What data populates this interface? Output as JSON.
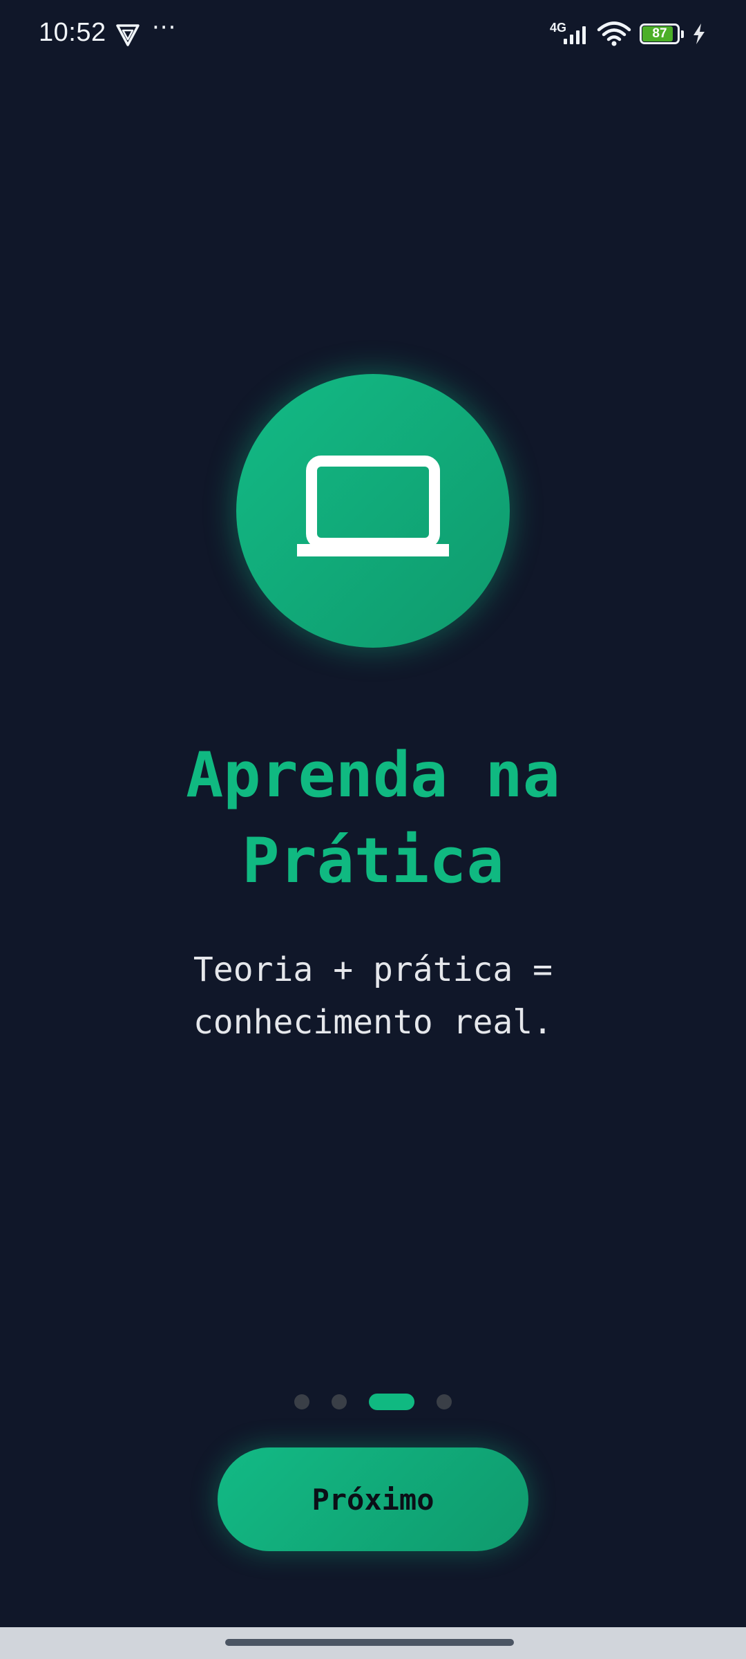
{
  "status_bar": {
    "time": "10:52",
    "more": "···",
    "network_label": "4G",
    "battery_level": 87,
    "battery_text": "87",
    "battery_color": "#4caf28",
    "icons": [
      "shield-app-icon",
      "signal-icon",
      "wifi-icon",
      "battery-icon",
      "charging-icon"
    ]
  },
  "onboarding": {
    "hero_icon": "laptop-icon",
    "title_line1": "Aprenda na",
    "title_line2": "Prática",
    "subtitle_line1": "Teoria + prática =",
    "subtitle_line2": "conhecimento real.",
    "page_count": 4,
    "current_page": 3,
    "next_label": "Próximo"
  },
  "colors": {
    "background": "#101729",
    "accent": "#10b981",
    "dot_inactive": "#3a3f47",
    "text_light": "#e5e7eb"
  }
}
